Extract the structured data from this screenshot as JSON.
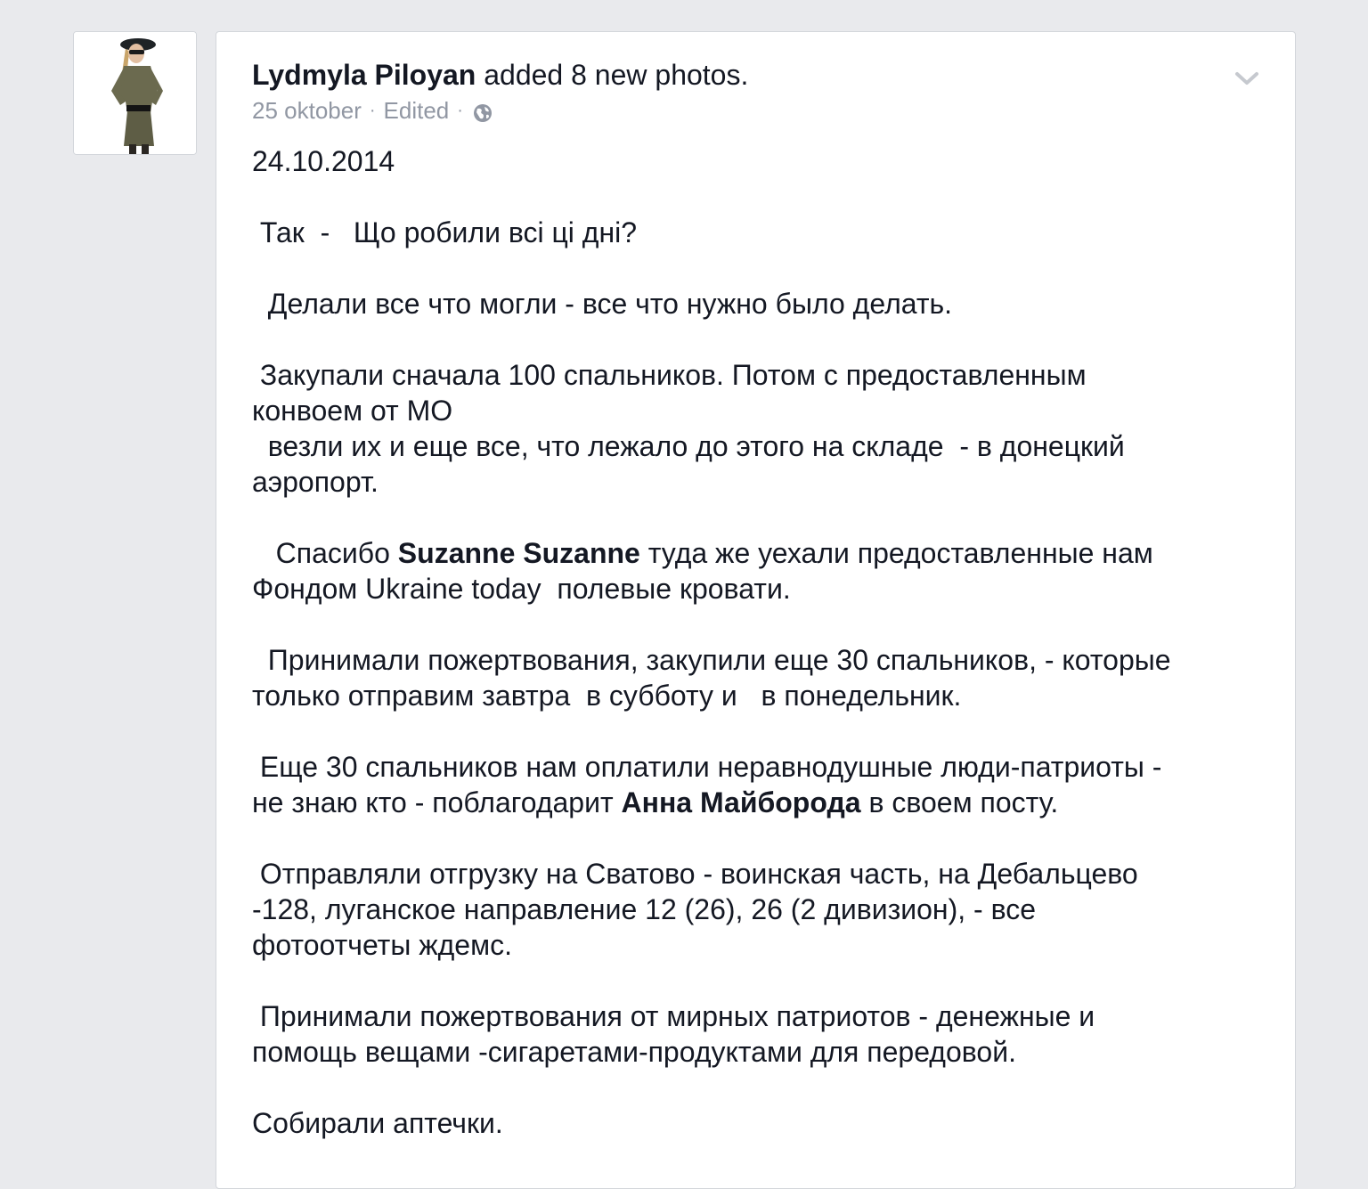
{
  "post": {
    "author": "Lydmyla Piloyan",
    "action": "added 8 new photos.",
    "date": "25 oktober",
    "edited": "Edited",
    "separator": "·",
    "body": {
      "p1": "24.10.2014",
      "p2": " Так  -   Що робили всі ці дні?",
      "p3": "  Делали все что могли - все что нужно было делать.",
      "p4_line1": " Закупали сначала 100 спальников. Потом с предоставленным",
      "p4_line2": "конвоем от МО",
      "p4_line3": "  везли их и еще все, что лежало до этого на складе  - в донецкий",
      "p4_line4": "аэропорт.",
      "p5_pre": "   Спасибо ",
      "p5_mention": "Suzanne Suzanne",
      "p5_post": " туда же уехали предоставленные нам",
      "p5_line2": "Фондом Ukraine today  полевые кровати.",
      "p6_line1": "  Принимали пожертвования, закупили еще 30 спальников, - которые",
      "p6_line2": "только отправим завтра  в субботу и   в понедельник.",
      "p7_line1": " Еще 30 спальников нам оплатили неравнодушные люди-патриоты -",
      "p7_pre": "не знаю кто - поблагодарит ",
      "p7_mention": "Анна Майборода",
      "p7_post": " в своем посту.",
      "p8_line1": " Отправляли отгрузку на Сватово - воинская часть, на Дебальцево",
      "p8_line2": "-128, луганское направление 12 (26), 26 (2 дивизион), - все",
      "p8_line3": "фотоотчеты ждемс.",
      "p9_line1": " Принимали пожертвования от мирных патриотов - денежные и",
      "p9_line2": "помощь вещами -сигаретами-продуктами для передовой.",
      "p10": "Собирали аптечки."
    }
  },
  "icons": {
    "audience": "globe-icon",
    "options": "chevron-down-icon"
  },
  "colors": {
    "page_background": "#e9eaed",
    "card_background": "#ffffff",
    "text": "#141823",
    "meta_text": "#9197a3",
    "border": "#d3d6db"
  }
}
